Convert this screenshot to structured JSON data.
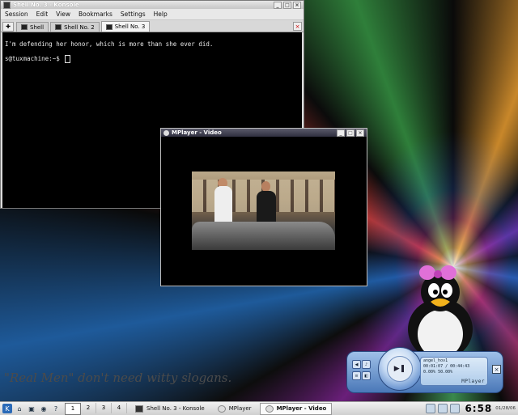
{
  "desktop": {
    "slogan": "\"Real Men\" don't need witty slogans."
  },
  "konsole": {
    "title": "Shell No. 3 - Konsole",
    "menu": [
      "Session",
      "Edit",
      "View",
      "Bookmarks",
      "Settings",
      "Help"
    ],
    "tabs": [
      {
        "label": "Shell",
        "active": false
      },
      {
        "label": "Shell No. 2",
        "active": false
      },
      {
        "label": "Shell No. 3",
        "active": true
      }
    ],
    "output_line": "I'm defending her honor, which is more than she ever did.",
    "prompt": "s@tuxmachine:~$"
  },
  "mplayer_video": {
    "title": "MPlayer - Video"
  },
  "mini_player": {
    "filename": "angel_hov1",
    "time": "00:01:07 / 00:44:43",
    "volume": "0.00%",
    "balance": "50.00%",
    "brand": "MPlayer"
  },
  "taskbar": {
    "pager": [
      "1",
      "2",
      "3",
      "4"
    ],
    "current_desktop": "1",
    "tasks": [
      {
        "label": "Shell No. 3 - Konsole",
        "active": false
      },
      {
        "label": "MPlayer",
        "active": false
      },
      {
        "label": "MPlayer - Video",
        "active": true
      }
    ],
    "clock": "6:58",
    "date": "01/28/06"
  },
  "colors": {
    "terminal_bg": "#000000",
    "terminal_fg": "#e8e8e8",
    "taskbar": "#dcdcdc",
    "mini_player_accent": "#4a78b8"
  }
}
